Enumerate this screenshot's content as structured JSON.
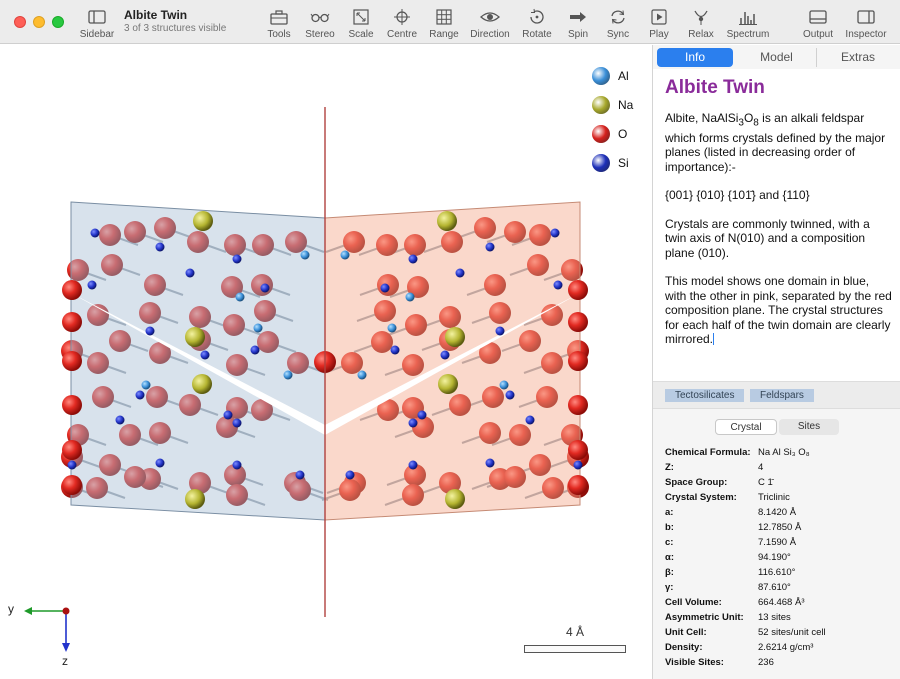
{
  "window": {
    "title": "Albite Twin",
    "subtitle": "3 of 3 structures visible"
  },
  "toolbar": {
    "sidebar": "Sidebar",
    "items": [
      "Tools",
      "Stereo",
      "Scale",
      "Centre",
      "Range",
      "Direction",
      "Rotate",
      "Spin",
      "Sync",
      "Play",
      "Relax",
      "Spectrum"
    ],
    "output": "Output",
    "inspector": "Inspector"
  },
  "legend": [
    {
      "symbol": "Al",
      "color": "#3a8fd8"
    },
    {
      "symbol": "Na",
      "color": "#a7a82c"
    },
    {
      "symbol": "O",
      "color": "#d6211d"
    },
    {
      "symbol": "Si",
      "color": "#1d2fb8"
    }
  ],
  "axes": {
    "y": "y",
    "z": "z"
  },
  "scale": {
    "label": "4 Å"
  },
  "inspector": {
    "tabs": {
      "info": "Info",
      "model": "Model",
      "extras": "Extras"
    },
    "title": "Albite Twin",
    "intro_prefix": "Albite, NaAlSi",
    "sub3": "3",
    "o_letter": "O",
    "sub8": "8",
    "intro_suffix": " is an alkali feldspar which forms crystals defined by the major planes (listed in decreasing order of importance):-",
    "planes": "{001} {010} {101̄} and {110}",
    "para2": "Crystals are commonly twinned, with a twin axis of N(010) and a composition plane (010).",
    "para3": "This model shows one domain in blue, with the other in pink, separated by the red composition plane. The crystal structures for each half of the twin domain are clearly mirrored.",
    "tags": [
      "Tectosilicates",
      "Feldspars"
    ],
    "subtabs": {
      "crystal": "Crystal",
      "sites": "Sites"
    },
    "properties": [
      {
        "k": "Chemical Formula:",
        "v": "Na Al Si₃ O₈"
      },
      {
        "k": "Z:",
        "v": "4"
      },
      {
        "k": "Space Group:",
        "v": "C 1̄"
      },
      {
        "k": "Crystal System:",
        "v": "Triclinic"
      },
      {
        "k": "a:",
        "v": "8.1420 Å"
      },
      {
        "k": "b:",
        "v": "12.7850 Å"
      },
      {
        "k": "c:",
        "v": "7.1590 Å"
      },
      {
        "k": "α:",
        "v": "94.190°"
      },
      {
        "k": "β:",
        "v": "116.610°"
      },
      {
        "k": "γ:",
        "v": "87.610°"
      },
      {
        "k": "Cell Volume:",
        "v": "664.468 Å³"
      },
      {
        "k": "Asymmetric Unit:",
        "v": "13 sites"
      },
      {
        "k": "Unit Cell:",
        "v": "52 sites/unit cell"
      },
      {
        "k": "Density:",
        "v": "2.6214 g/cm³"
      },
      {
        "k": "Visible Sites:",
        "v": "236"
      }
    ]
  }
}
